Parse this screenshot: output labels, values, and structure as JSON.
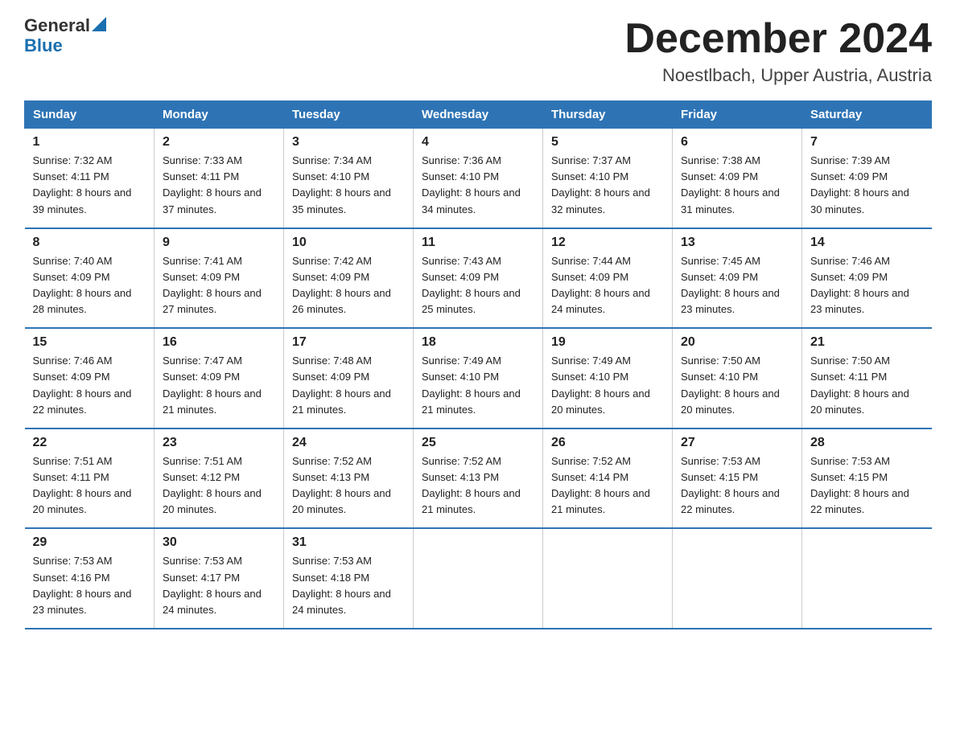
{
  "header": {
    "logo_general": "General",
    "logo_blue": "Blue",
    "month_title": "December 2024",
    "location": "Noestlbach, Upper Austria, Austria"
  },
  "weekdays": [
    "Sunday",
    "Monday",
    "Tuesday",
    "Wednesday",
    "Thursday",
    "Friday",
    "Saturday"
  ],
  "weeks": [
    [
      {
        "day": "1",
        "sunrise": "7:32 AM",
        "sunset": "4:11 PM",
        "daylight": "8 hours and 39 minutes."
      },
      {
        "day": "2",
        "sunrise": "7:33 AM",
        "sunset": "4:11 PM",
        "daylight": "8 hours and 37 minutes."
      },
      {
        "day": "3",
        "sunrise": "7:34 AM",
        "sunset": "4:10 PM",
        "daylight": "8 hours and 35 minutes."
      },
      {
        "day": "4",
        "sunrise": "7:36 AM",
        "sunset": "4:10 PM",
        "daylight": "8 hours and 34 minutes."
      },
      {
        "day": "5",
        "sunrise": "7:37 AM",
        "sunset": "4:10 PM",
        "daylight": "8 hours and 32 minutes."
      },
      {
        "day": "6",
        "sunrise": "7:38 AM",
        "sunset": "4:09 PM",
        "daylight": "8 hours and 31 minutes."
      },
      {
        "day": "7",
        "sunrise": "7:39 AM",
        "sunset": "4:09 PM",
        "daylight": "8 hours and 30 minutes."
      }
    ],
    [
      {
        "day": "8",
        "sunrise": "7:40 AM",
        "sunset": "4:09 PM",
        "daylight": "8 hours and 28 minutes."
      },
      {
        "day": "9",
        "sunrise": "7:41 AM",
        "sunset": "4:09 PM",
        "daylight": "8 hours and 27 minutes."
      },
      {
        "day": "10",
        "sunrise": "7:42 AM",
        "sunset": "4:09 PM",
        "daylight": "8 hours and 26 minutes."
      },
      {
        "day": "11",
        "sunrise": "7:43 AM",
        "sunset": "4:09 PM",
        "daylight": "8 hours and 25 minutes."
      },
      {
        "day": "12",
        "sunrise": "7:44 AM",
        "sunset": "4:09 PM",
        "daylight": "8 hours and 24 minutes."
      },
      {
        "day": "13",
        "sunrise": "7:45 AM",
        "sunset": "4:09 PM",
        "daylight": "8 hours and 23 minutes."
      },
      {
        "day": "14",
        "sunrise": "7:46 AM",
        "sunset": "4:09 PM",
        "daylight": "8 hours and 23 minutes."
      }
    ],
    [
      {
        "day": "15",
        "sunrise": "7:46 AM",
        "sunset": "4:09 PM",
        "daylight": "8 hours and 22 minutes."
      },
      {
        "day": "16",
        "sunrise": "7:47 AM",
        "sunset": "4:09 PM",
        "daylight": "8 hours and 21 minutes."
      },
      {
        "day": "17",
        "sunrise": "7:48 AM",
        "sunset": "4:09 PM",
        "daylight": "8 hours and 21 minutes."
      },
      {
        "day": "18",
        "sunrise": "7:49 AM",
        "sunset": "4:10 PM",
        "daylight": "8 hours and 21 minutes."
      },
      {
        "day": "19",
        "sunrise": "7:49 AM",
        "sunset": "4:10 PM",
        "daylight": "8 hours and 20 minutes."
      },
      {
        "day": "20",
        "sunrise": "7:50 AM",
        "sunset": "4:10 PM",
        "daylight": "8 hours and 20 minutes."
      },
      {
        "day": "21",
        "sunrise": "7:50 AM",
        "sunset": "4:11 PM",
        "daylight": "8 hours and 20 minutes."
      }
    ],
    [
      {
        "day": "22",
        "sunrise": "7:51 AM",
        "sunset": "4:11 PM",
        "daylight": "8 hours and 20 minutes."
      },
      {
        "day": "23",
        "sunrise": "7:51 AM",
        "sunset": "4:12 PM",
        "daylight": "8 hours and 20 minutes."
      },
      {
        "day": "24",
        "sunrise": "7:52 AM",
        "sunset": "4:13 PM",
        "daylight": "8 hours and 20 minutes."
      },
      {
        "day": "25",
        "sunrise": "7:52 AM",
        "sunset": "4:13 PM",
        "daylight": "8 hours and 21 minutes."
      },
      {
        "day": "26",
        "sunrise": "7:52 AM",
        "sunset": "4:14 PM",
        "daylight": "8 hours and 21 minutes."
      },
      {
        "day": "27",
        "sunrise": "7:53 AM",
        "sunset": "4:15 PM",
        "daylight": "8 hours and 22 minutes."
      },
      {
        "day": "28",
        "sunrise": "7:53 AM",
        "sunset": "4:15 PM",
        "daylight": "8 hours and 22 minutes."
      }
    ],
    [
      {
        "day": "29",
        "sunrise": "7:53 AM",
        "sunset": "4:16 PM",
        "daylight": "8 hours and 23 minutes."
      },
      {
        "day": "30",
        "sunrise": "7:53 AM",
        "sunset": "4:17 PM",
        "daylight": "8 hours and 24 minutes."
      },
      {
        "day": "31",
        "sunrise": "7:53 AM",
        "sunset": "4:18 PM",
        "daylight": "8 hours and 24 minutes."
      },
      null,
      null,
      null,
      null
    ]
  ]
}
